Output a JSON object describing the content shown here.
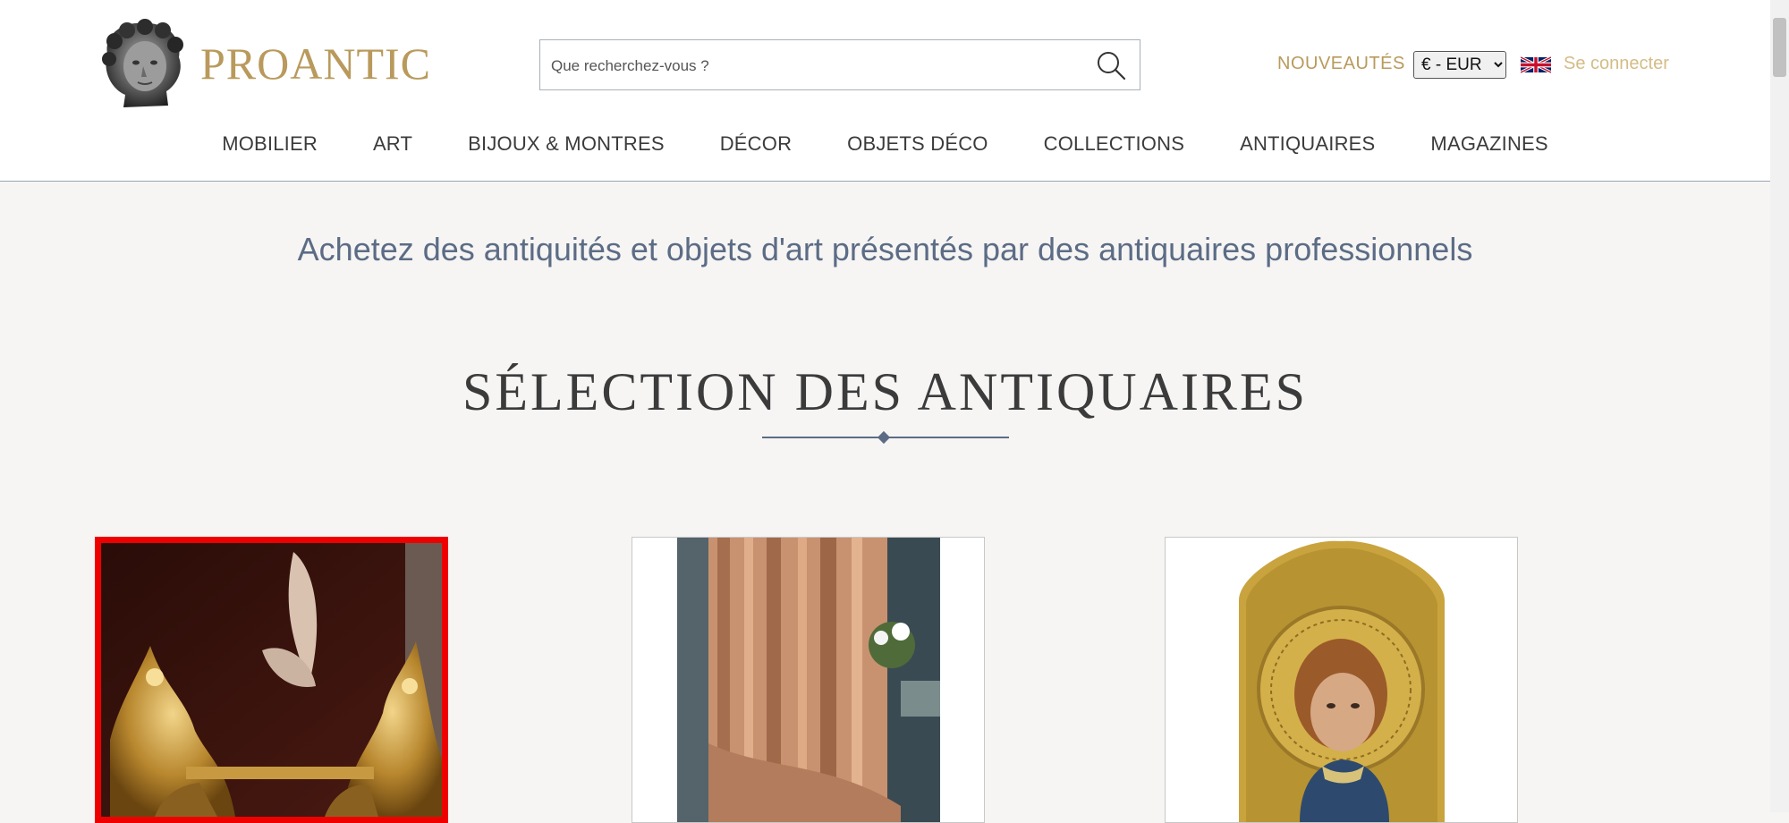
{
  "header": {
    "logo_text": "PROANTIC",
    "search": {
      "placeholder": "Que recherchez-vous ?",
      "value": ""
    },
    "nouveautes_label": "NOUVEAUTÉS",
    "currency": {
      "selected": "€ - EUR",
      "options": [
        "€ - EUR"
      ]
    },
    "login_label": "Se connecter"
  },
  "nav": {
    "items": [
      "MOBILIER",
      "ART",
      "BIJOUX & MONTRES",
      "DÉCOR",
      "OBJETS DÉCO",
      "COLLECTIONS",
      "ANTIQUAIRES",
      "MAGAZINES"
    ]
  },
  "main": {
    "tagline": "Achetez des antiquités et objets d'art présentés par des antiquaires professionnels",
    "section_title": "SÉLECTION DES ANTIQUAIRES"
  },
  "colors": {
    "brand_gold": "#b99a5c",
    "login_gold": "#d4bc86",
    "accent_slate": "#5c6c85",
    "selected_border": "#ee0000",
    "page_background": "#f6f5f4"
  },
  "icons": {
    "search": "search-icon",
    "flag": "uk-flag-icon",
    "logo": "classical-bust-logo-icon"
  }
}
